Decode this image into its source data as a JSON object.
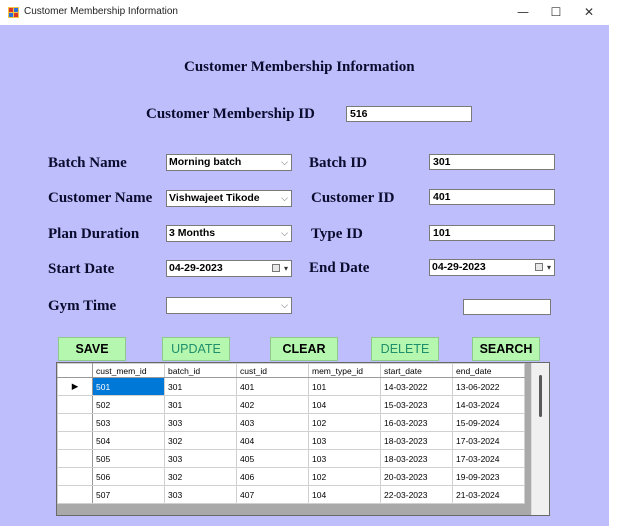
{
  "window": {
    "title": "Customer Membership Information",
    "controls": {
      "minimize": "—",
      "maximize": "☐",
      "close": "✕"
    }
  },
  "form": {
    "heading": "Customer Membership Information",
    "membership_id": {
      "label": "Customer Membership ID",
      "value": "516"
    },
    "batch_name": {
      "label": "Batch Name",
      "value": "Morning batch"
    },
    "batch_id": {
      "label": "Batch ID",
      "value": "301"
    },
    "customer_name": {
      "label": "Customer Name",
      "value": "Vishwajeet Tikode"
    },
    "customer_id": {
      "label": "Customer ID",
      "value": "401"
    },
    "plan_duration": {
      "label": "Plan Duration",
      "value": "3 Months"
    },
    "type_id": {
      "label": "Type ID",
      "value": "101"
    },
    "start_date": {
      "label": "Start Date",
      "value": "04-29-2023"
    },
    "end_date": {
      "label": "End Date",
      "value": "04-29-2023"
    },
    "gym_time": {
      "label": "Gym Time",
      "value": ""
    },
    "extra_field": {
      "value": ""
    }
  },
  "buttons": {
    "save": "SAVE",
    "update": "UPDATE",
    "clear": "CLEAR",
    "delete": "DELETE",
    "search": "SEARCH"
  },
  "grid": {
    "columns": [
      "cust_mem_id",
      "batch_id",
      "cust_id",
      "mem_type_id",
      "start_date",
      "end_date"
    ],
    "current_row_marker": "▶",
    "rows": [
      [
        "501",
        "301",
        "401",
        "101",
        "14-03-2022",
        "13-06-2022"
      ],
      [
        "502",
        "301",
        "402",
        "104",
        "15-03-2023",
        "14-03-2024"
      ],
      [
        "503",
        "303",
        "403",
        "102",
        "16-03-2023",
        "15-09-2024"
      ],
      [
        "504",
        "302",
        "404",
        "103",
        "18-03-2023",
        "17-03-2024"
      ],
      [
        "505",
        "303",
        "405",
        "103",
        "18-03-2023",
        "17-03-2024"
      ],
      [
        "506",
        "302",
        "406",
        "102",
        "20-03-2023",
        "19-09-2023"
      ],
      [
        "507",
        "303",
        "407",
        "104",
        "22-03-2023",
        "21-03-2024"
      ]
    ]
  },
  "colors": {
    "form_background": "#bebefd",
    "button_background": "#b6f7b0",
    "selected_cell": "#0078d7"
  }
}
